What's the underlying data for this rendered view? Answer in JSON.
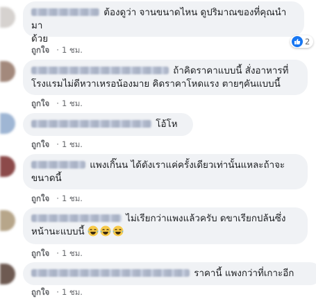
{
  "comments": [
    {
      "text_line1": "ต้องดูว่า จานขนาดไหน ดูปริมาณของที่คุณนำมา",
      "text_line2": "ด้วย",
      "like_label": "ถูกใจ",
      "time": "1 ชม.",
      "reaction_count": "2",
      "avatar_color": "#d6d2cf"
    },
    {
      "text_line1": "ถ้าคิดราคาแบบนี้ สั่งอาหารที่",
      "text_line2": "โรงแรมไม่ดีหวาเหรอน้องมาย คิดราคาโหดแรง ตายๆคันแบบนี้",
      "like_label": "ถูกใจ",
      "time": "1 ชม.",
      "avatar_color": "#a3897c"
    },
    {
      "text_line1": "โอ้โห",
      "like_label": "ถูกใจ",
      "time": "1 ชม.",
      "avatar_color": "#9fb6d4"
    },
    {
      "text_line1": "แพงเกิ๊นน ได้ดังเราแค่ครั้งเดียวเท่านั้นแหละถ้าจะ",
      "text_line2": "ขนาดนี้",
      "like_label": "ถูกใจ",
      "time": "1 ชม.",
      "avatar_color": "#8c4a4a"
    },
    {
      "text_line1": "ไม่เรียกว่าแพงแล้วครับ ดขาเรียกปล้นซึ่ง",
      "text_line2": "หน้านะแบบนี้",
      "like_label": "ถูกใจ",
      "time": "1 ชม.",
      "avatar_color": "#b7a68a"
    },
    {
      "text_line1": "ราคานี้ แพงกว่าที่เกาะอีก",
      "like_label": "ถูกใจ",
      "time": "1 ชม.",
      "avatar_color": "#6e5a52"
    }
  ],
  "meta_separator": "·",
  "colors": {
    "bubble": "#f0f2f5",
    "meta_text": "#65676b",
    "like_blue": "#1877f2"
  },
  "icons": {
    "reaction": "thumbs-up-icon",
    "emoji": "laughing-tears-emoji-icon"
  }
}
